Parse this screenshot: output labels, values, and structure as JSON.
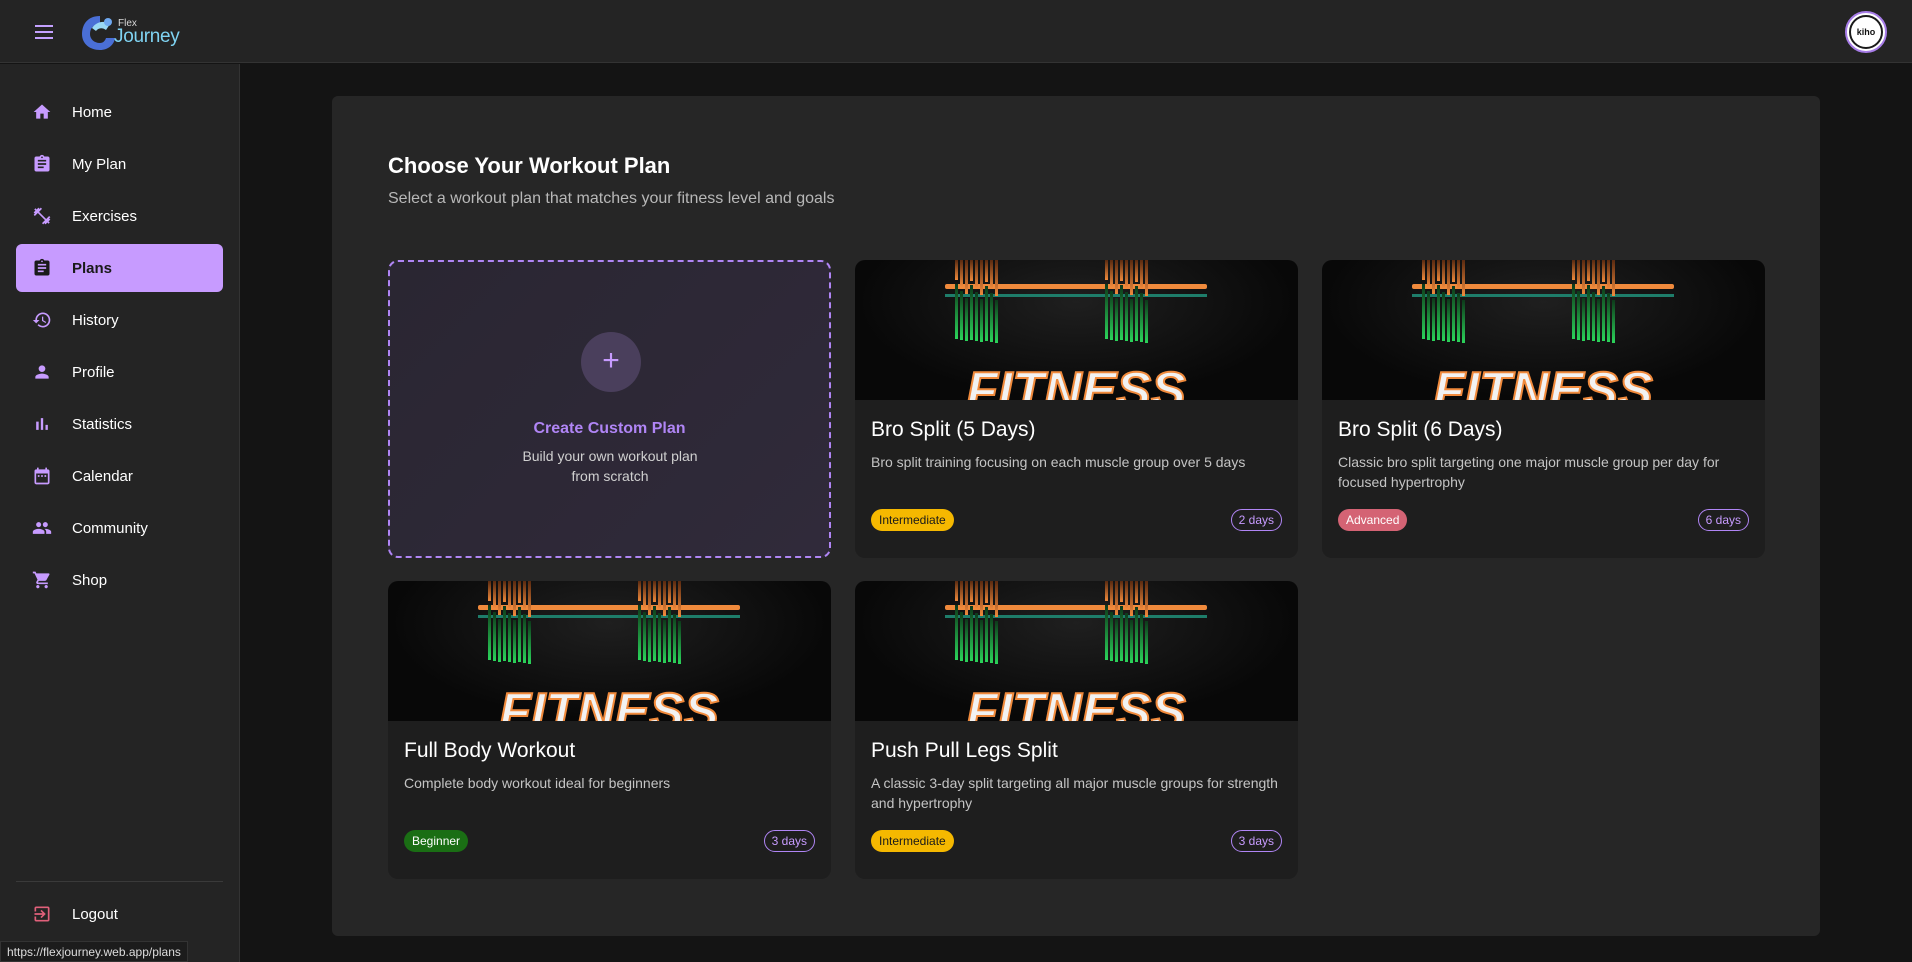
{
  "header": {
    "logo_small": "Flex",
    "logo_big": "Journey",
    "avatar_text": "kiho"
  },
  "sidebar": {
    "items": [
      {
        "label": "Home",
        "icon": "home-icon"
      },
      {
        "label": "My Plan",
        "icon": "clipboard-icon"
      },
      {
        "label": "Exercises",
        "icon": "dumbbell-icon"
      },
      {
        "label": "Plans",
        "icon": "clipboard-icon",
        "active": true
      },
      {
        "label": "History",
        "icon": "history-icon"
      },
      {
        "label": "Profile",
        "icon": "person-icon"
      },
      {
        "label": "Statistics",
        "icon": "bar-chart-icon"
      },
      {
        "label": "Calendar",
        "icon": "calendar-icon"
      },
      {
        "label": "Community",
        "icon": "people-icon"
      },
      {
        "label": "Shop",
        "icon": "cart-icon"
      }
    ],
    "logout_label": "Logout"
  },
  "main": {
    "title": "Choose Your Workout Plan",
    "subtitle": "Select a workout plan that matches your fitness level and goals",
    "custom_plan": {
      "plus": "+",
      "title": "Create Custom Plan",
      "description": "Build your own workout plan from scratch"
    },
    "image_text": "FITNESS",
    "plans": [
      {
        "title": "Bro Split (5 Days)",
        "description": "Bro split training focusing on each muscle group over 5 days",
        "level": "Intermediate",
        "days": "2 days"
      },
      {
        "title": "Bro Split (6 Days)",
        "description": "Classic bro split targeting one major muscle group per day for focused hypertrophy",
        "level": "Advanced",
        "days": "6 days"
      },
      {
        "title": "Full Body Workout",
        "description": "Complete body workout ideal for beginners",
        "level": "Beginner",
        "days": "3 days"
      },
      {
        "title": "Push Pull Legs Split",
        "description": "A classic 3-day split targeting all major muscle groups for strength and hypertrophy",
        "level": "Intermediate",
        "days": "3 days"
      }
    ]
  },
  "status_bar": {
    "url": "https://flexjourney.web.app/plans"
  },
  "colors": {
    "accent": "#c79bff",
    "intermediate": "#f5b800",
    "advanced": "#d46374",
    "beginner": "#1a6e14"
  }
}
